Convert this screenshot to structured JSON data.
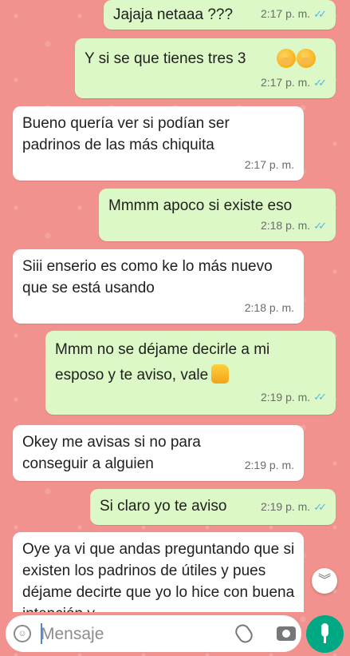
{
  "messages": [
    {
      "text": "Jajaja netaaa ???",
      "time": "2:17 p. m."
    },
    {
      "text": "Y si se que tienes tres 3",
      "time": "2:17 p. m."
    },
    {
      "text": "Bueno quería ver si podían ser padrinos de las más chiquita",
      "time": "2:17 p. m."
    },
    {
      "text": "Mmmm apoco si existe eso",
      "time": "2:18 p. m."
    },
    {
      "text": "Siii enserio  es como ke lo más nuevo que se está usando",
      "time": "2:18 p. m."
    },
    {
      "text": "Mmm no se déjame decirle a mi esposo y te aviso, vale",
      "time": "2:19 p. m."
    },
    {
      "text": "Okey me avisas si no para conseguir a alguien",
      "time": "2:19 p. m."
    },
    {
      "text": "Si claro yo te aviso",
      "time": "2:19 p. m."
    },
    {
      "text": "Oye ya vi que andas preguntando que si existen los padrinos de útiles  y pues déjame decirte que yo lo hice  con buena intención y"
    }
  ],
  "input": {
    "placeholder": "Mensaje"
  },
  "icons": {
    "read_receipt": "double-check-icon",
    "emoji": "emoji-icon",
    "attach": "paperclip-icon",
    "camera": "camera-icon",
    "mic": "microphone-icon",
    "scroll": "chevron-down-double-icon"
  },
  "colors": {
    "outgoing": "#dcf8c6",
    "incoming": "#ffffff",
    "read_receipt": "#4fb6ec",
    "mic": "#00a884"
  }
}
